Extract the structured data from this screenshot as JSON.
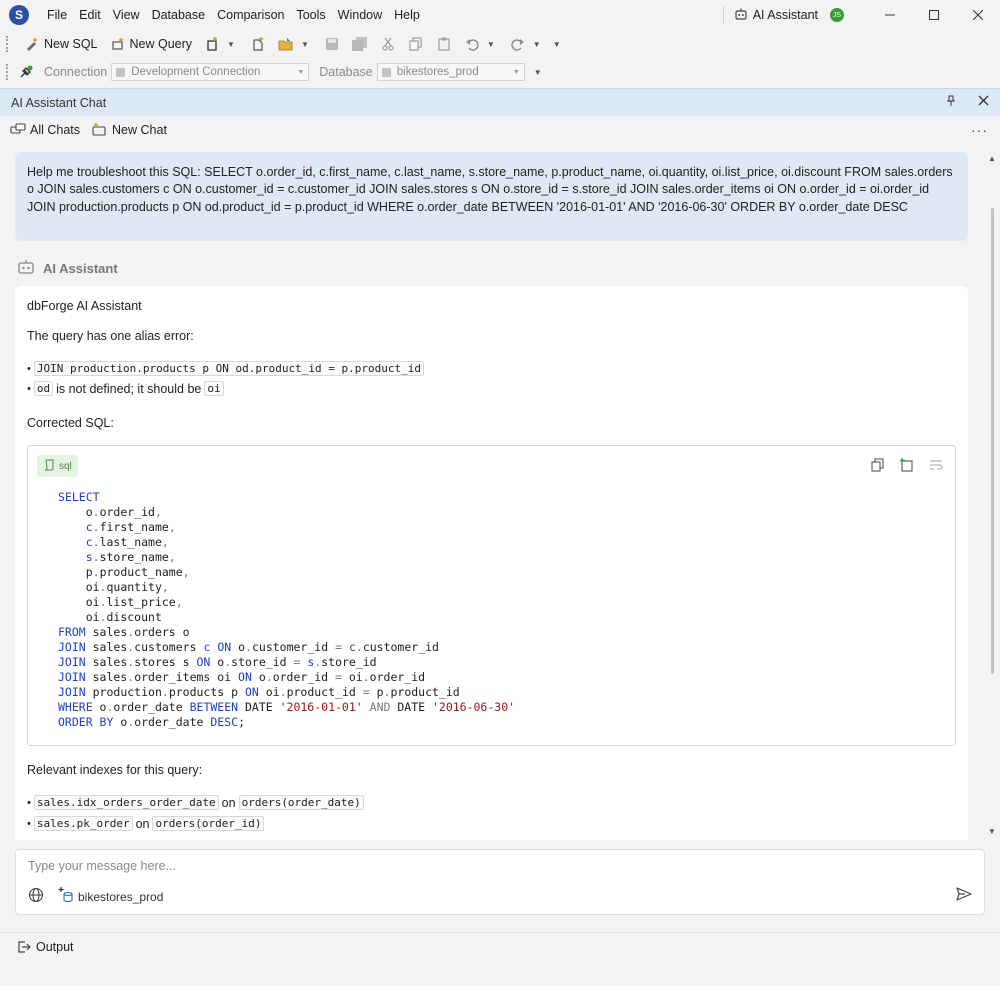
{
  "menu": [
    "File",
    "Edit",
    "View",
    "Database",
    "Comparison",
    "Tools",
    "Window",
    "Help"
  ],
  "titlebar": {
    "ai_assistant": "AI Assistant",
    "avatar_initials": "JS"
  },
  "toolbar": {
    "new_sql": "New SQL",
    "new_query": "New Query"
  },
  "connection": {
    "label": "Connection",
    "value": "Development Connection",
    "db_label": "Database",
    "db_value": "bikestores_prod"
  },
  "panel": {
    "title": "AI Assistant Chat",
    "all_chats": "All Chats",
    "new_chat": "New Chat"
  },
  "user_message": "Help me troubleshoot this SQL: SELECT o.order_id, c.first_name, c.last_name, s.store_name, p.product_name, oi.quantity, oi.list_price, oi.discount FROM sales.orders o JOIN sales.customers c ON o.customer_id = c.customer_id JOIN sales.stores s ON o.store_id = s.store_id JOIN sales.order_items oi ON o.order_id = oi.order_id JOIN production.products p ON od.product_id = p.product_id WHERE o.order_date BETWEEN '2016-01-01' AND '2016-06-30' ORDER BY o.order_date DESC",
  "assistant": {
    "name": "AI Assistant",
    "header": "dbForge AI Assistant",
    "intro": "The query has one alias error:",
    "bullet1_code": "JOIN production.products p ON od.product_id = p.product_id",
    "bullet2_code_a": "od",
    "bullet2_text": "is not defined; it should be",
    "bullet2_code_b": "oi",
    "corrected_label": "Corrected SQL:",
    "code_lang": "sql",
    "indexes_label": "Relevant indexes for this query:",
    "idx1_a": "sales.idx_orders_order_date",
    "idx1_on": "on",
    "idx1_b": "orders(order_date)",
    "idx2_a": "sales.pk_order",
    "idx2_on": "on",
    "idx2_b": "orders(order_id)"
  },
  "input": {
    "placeholder": "Type your message here...",
    "context_db": "bikestores_prod"
  },
  "status": {
    "output": "Output"
  },
  "colors": {
    "keyword": "#1f3fbf",
    "string": "#a31515",
    "panel_header": "#dde8f7",
    "user_bubble": "#dfe8f5"
  }
}
